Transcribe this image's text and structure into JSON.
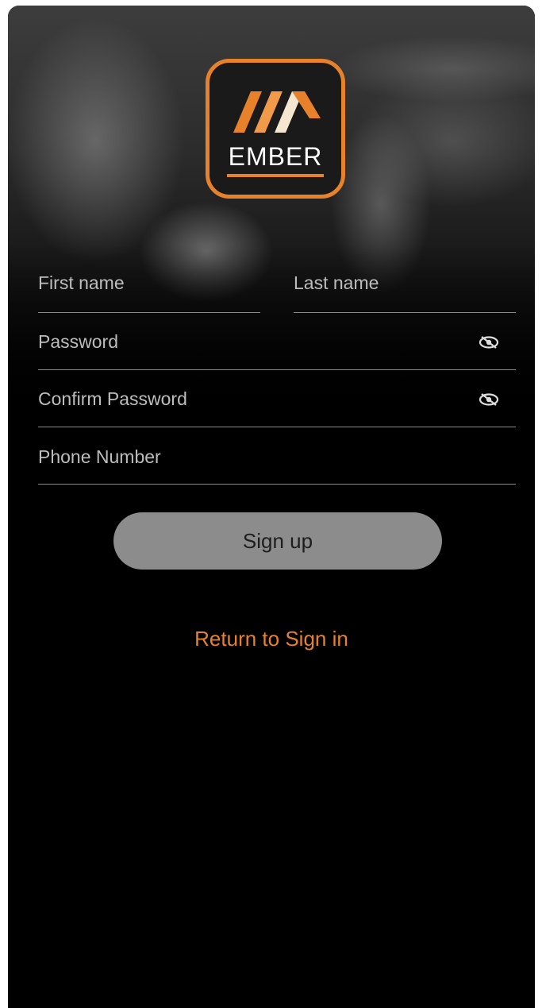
{
  "brand": {
    "name": "EMBER",
    "accent_color": "#e8822a"
  },
  "form": {
    "first_name": {
      "placeholder": "First name"
    },
    "last_name": {
      "placeholder": "Last name"
    },
    "password": {
      "placeholder": "Password",
      "icon": "eye-off-icon"
    },
    "confirm_password": {
      "placeholder": "Confirm Password",
      "icon": "eye-off-icon"
    },
    "phone_number": {
      "placeholder": "Phone Number"
    }
  },
  "actions": {
    "signup_label": "Sign up",
    "return_label": "Return to Sign in"
  }
}
